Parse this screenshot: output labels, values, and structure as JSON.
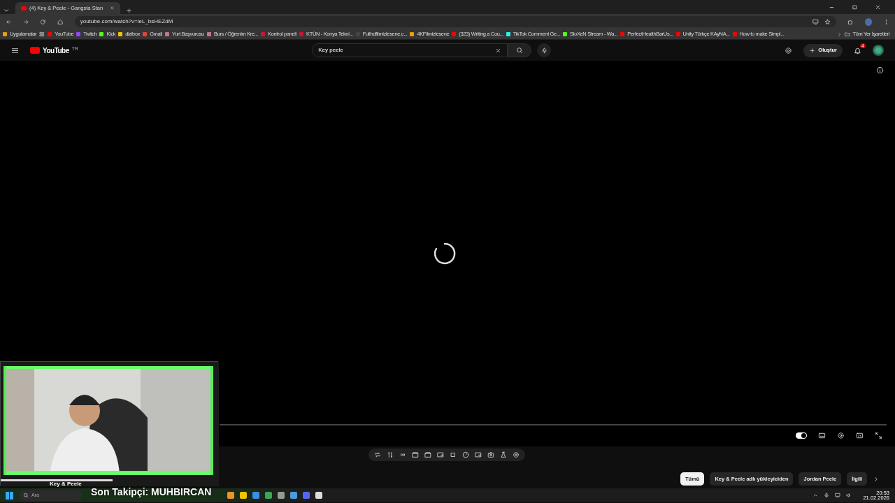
{
  "browser": {
    "tab_title": "(4) Key & Peele - Gangsta Stan",
    "address": "youtube.com/watch?v=leL_bsHEZdM",
    "bookmarks": [
      {
        "label": "Uygulamalar",
        "color": "#e5a00d"
      },
      {
        "label": "YouTube",
        "color": "#ff0000"
      },
      {
        "label": "Twitch",
        "color": "#9146ff"
      },
      {
        "label": "Kick",
        "color": "#53fc18"
      },
      {
        "label": "dizibox",
        "color": "#f2c200"
      },
      {
        "label": "Gmail",
        "color": "#ea4335"
      },
      {
        "label": "Yurt Başvurusu",
        "color": "#c0788a"
      },
      {
        "label": "Burs / Öğrenim Kre...",
        "color": "#c0788a"
      },
      {
        "label": "Kontrol paneli",
        "color": "#d0103a"
      },
      {
        "label": "KTÜN - Konya Tekni...",
        "color": "#d0103a"
      },
      {
        "label": "Fullhdfilmizlesene.c...",
        "color": "#444444"
      },
      {
        "label": "4KFilmizlesene",
        "color": "#e5a00d"
      },
      {
        "label": "(323) Writing a Cou...",
        "color": "#ff0000"
      },
      {
        "label": "TikTok Comment Ge...",
        "color": "#25f4ee"
      },
      {
        "label": "SloXeN Stream - Wa...",
        "color": "#53fc18"
      },
      {
        "label": "PerfectHealthBarUs...",
        "color": "#ff0000"
      },
      {
        "label": "Unity Türkçe KAyNA...",
        "color": "#ff0000"
      },
      {
        "label": "How to make Simpl...",
        "color": "#ff0000"
      }
    ],
    "all_bookmarks": "Tüm Yer İşaretleri"
  },
  "youtube": {
    "logo": "YouTube",
    "region": "TR",
    "search_value": "Key peele",
    "create_label": "Oluştur",
    "notifications": "4"
  },
  "chips": [
    {
      "label": "Tümü",
      "selected": true
    },
    {
      "label": "Key & Peele adlı yükleyiciden",
      "selected": false
    },
    {
      "label": "Jordan Peele",
      "selected": false
    },
    {
      "label": "İlgili",
      "selected": false
    }
  ],
  "channel_name": "Key & Peele",
  "player": {
    "autoplay_on": true
  },
  "overlay_text": "Son Takipçi: MUHBIRCAN",
  "taskbar": {
    "search_placeholder": "Ara",
    "time": "20:53",
    "date": "21.02.2026"
  }
}
